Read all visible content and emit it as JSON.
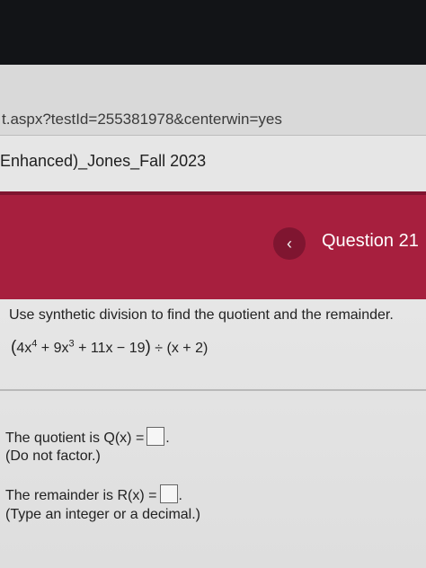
{
  "browser": {
    "url": "t.aspx?testId=255381978&centerwin=yes"
  },
  "course": {
    "title": "Enhanced)_Jones_Fall 2023"
  },
  "header": {
    "prev_icon": "‹",
    "question_label": "Question 21",
    "colors": {
      "banner": "#a71f3e",
      "button": "#7f1530"
    }
  },
  "question": {
    "prompt": "Use synthetic division to find the quotient and the remainder.",
    "expression": {
      "open_paren": "(",
      "t1_coef": "4x",
      "t1_exp": "4",
      "plus1": " + ",
      "t2_coef": "9x",
      "t2_exp": "3",
      "rest": " + 11x − 19",
      "close_paren": ")",
      "divisor": " ÷ (x + 2)"
    }
  },
  "answers": {
    "quotient_label": "The quotient is Q(x) =",
    "quotient_hint": "(Do not factor.)",
    "remainder_label": "The remainder is R(x) =",
    "remainder_hint": "(Type an integer or a decimal.)",
    "terminal": "."
  }
}
